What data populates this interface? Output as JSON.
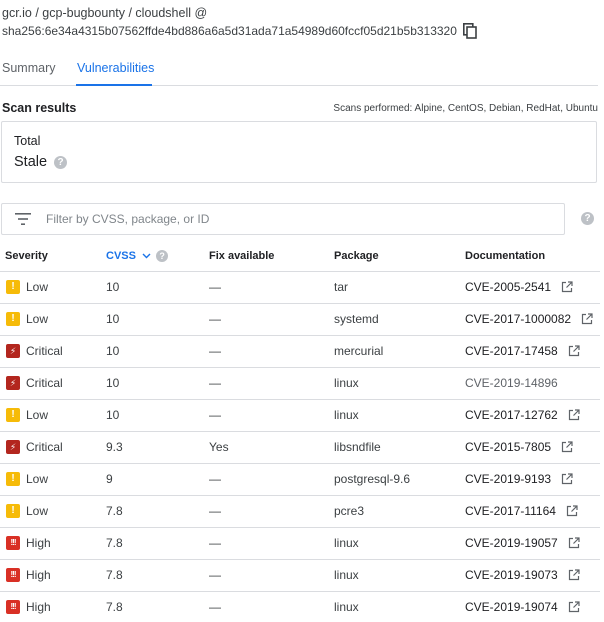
{
  "header": {
    "path": "gcr.io / gcp-bugbounty / cloudshell @",
    "sha": "sha256:6e34a4315b07562ffde4bd886a6a5d31ada71a54989d60fccf05d21b5b313320",
    "copy_icon": "copy-icon"
  },
  "tabs": [
    {
      "label": "Summary",
      "active": false
    },
    {
      "label": "Vulnerabilities",
      "active": true
    }
  ],
  "scan": {
    "title": "Scan results",
    "performed": "Scans performed: Alpine, CentOS, Debian, RedHat, Ubuntu"
  },
  "total": {
    "label": "Total",
    "value": "Stale"
  },
  "filter": {
    "placeholder": "Filter by CVSS, package, or ID"
  },
  "table": {
    "headers": {
      "severity": "Severity",
      "cvss": "CVSS",
      "fix": "Fix available",
      "package": "Package",
      "documentation": "Documentation"
    },
    "rows": [
      {
        "severity": "Low",
        "cvss": "10",
        "fix": "—",
        "package": "tar",
        "doc": "CVE-2005-2541",
        "ext": true
      },
      {
        "severity": "Low",
        "cvss": "10",
        "fix": "—",
        "package": "systemd",
        "doc": "CVE-2017-1000082",
        "ext": true
      },
      {
        "severity": "Critical",
        "cvss": "10",
        "fix": "—",
        "package": "mercurial",
        "doc": "CVE-2017-17458",
        "ext": true
      },
      {
        "severity": "Critical",
        "cvss": "10",
        "fix": "—",
        "package": "linux",
        "doc": "CVE-2019-14896",
        "ext": false
      },
      {
        "severity": "Low",
        "cvss": "10",
        "fix": "—",
        "package": "linux",
        "doc": "CVE-2017-12762",
        "ext": true
      },
      {
        "severity": "Critical",
        "cvss": "9.3",
        "fix": "Yes",
        "package": "libsndfile",
        "doc": "CVE-2015-7805",
        "ext": true
      },
      {
        "severity": "Low",
        "cvss": "9",
        "fix": "—",
        "package": "postgresql-9.6",
        "doc": "CVE-2019-9193",
        "ext": true
      },
      {
        "severity": "Low",
        "cvss": "7.8",
        "fix": "—",
        "package": "pcre3",
        "doc": "CVE-2017-11164",
        "ext": true
      },
      {
        "severity": "High",
        "cvss": "7.8",
        "fix": "—",
        "package": "linux",
        "doc": "CVE-2019-19057",
        "ext": true
      },
      {
        "severity": "High",
        "cvss": "7.8",
        "fix": "—",
        "package": "linux",
        "doc": "CVE-2019-19073",
        "ext": true
      },
      {
        "severity": "High",
        "cvss": "7.8",
        "fix": "—",
        "package": "linux",
        "doc": "CVE-2019-19074",
        "ext": true
      }
    ]
  },
  "colors": {
    "accent": "#1a73e8",
    "low": "#f6bb08",
    "critical": "#b3261e",
    "high": "#d93025"
  }
}
